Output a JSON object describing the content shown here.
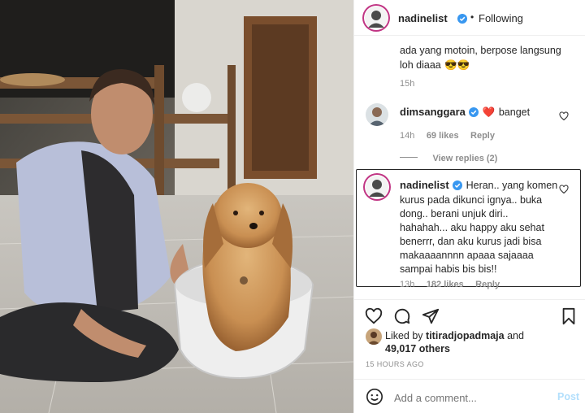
{
  "post": {
    "username": "nadinelist",
    "separator": "•",
    "follow_status": "Following"
  },
  "comments": [
    {
      "text": "ada yang motoin, berpose langsung loh diaaa",
      "emoji": "😎😎",
      "time": "15h"
    },
    {
      "username": "dimsanggara",
      "text": "banget",
      "emoji": "❤️",
      "time": "14h",
      "likes": "69 likes",
      "reply_label": "Reply",
      "view_replies": "View replies (2)"
    },
    {
      "username": "nadinelist",
      "text_lines": [
        "Heran.. yang komen",
        "kurus pada dikunci ignya.. buka",
        "dong.. berani unjuk diri..",
        "hahahah... aku happy aku sehat",
        "benerrr, dan aku kurus jadi bisa",
        "makaaaannnn apaaa sajaaaa",
        "sampai habis bis bis!!"
      ],
      "time": "13h",
      "likes": "182 likes",
      "reply_label": "Reply"
    }
  ],
  "likes": {
    "prefix": "Liked by",
    "user": "titiradjopadmaja",
    "conj": "and",
    "count": "49,017 others"
  },
  "timestamp": "15 HOURS AGO",
  "add_comment": {
    "placeholder": "Add a comment...",
    "post_label": "Post"
  },
  "icons": {
    "like": "heart-icon",
    "comment": "comment-icon",
    "share": "paper-plane-icon",
    "save": "bookmark-icon",
    "emoji": "smiley-icon",
    "verified": "verified-badge-icon"
  },
  "colors": {
    "verified": "#3897f0",
    "text": "#262626",
    "muted": "#8e8e8e",
    "link": "#b2dffc"
  }
}
